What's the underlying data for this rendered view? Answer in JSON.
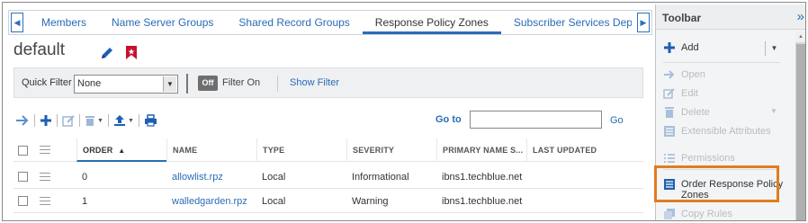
{
  "tabs": [
    {
      "label": "Members",
      "active": false
    },
    {
      "label": "Name Server Groups",
      "active": false
    },
    {
      "label": "Shared Record Groups",
      "active": false
    },
    {
      "label": "Response Policy Zones",
      "active": true
    },
    {
      "label": "Subscriber Services Deployment",
      "active": false
    }
  ],
  "page": {
    "title": "default"
  },
  "filter": {
    "quick_filter_label": "Quick Filter",
    "quick_filter_value": "None",
    "toggle_label": "Off",
    "filter_state": "Filter On",
    "show_filter": "Show Filter"
  },
  "goto": {
    "label": "Go to",
    "button": "Go",
    "value": ""
  },
  "table": {
    "columns": [
      "ORDER",
      "NAME",
      "TYPE",
      "SEVERITY",
      "PRIMARY NAME S...",
      "LAST UPDATED"
    ],
    "sort_indicator": "▲",
    "rows": [
      {
        "order": "0",
        "name": "allowlist.rpz",
        "type": "Local",
        "severity": "Informational",
        "primary": "ibns1.techblue.net",
        "updated": ""
      },
      {
        "order": "1",
        "name": "walledgarden.rpz",
        "type": "Local",
        "severity": "Warning",
        "primary": "ibns1.techblue.net",
        "updated": ""
      }
    ]
  },
  "toolbar": {
    "title": "Toolbar",
    "items": [
      {
        "label": "Add",
        "enabled": true,
        "icon": "plus-icon"
      },
      {
        "label": "Open",
        "enabled": false,
        "icon": "arrow-right-icon"
      },
      {
        "label": "Edit",
        "enabled": false,
        "icon": "pencil-icon"
      },
      {
        "label": "Delete",
        "enabled": false,
        "icon": "trash-icon"
      },
      {
        "label": "Extensible Attributes",
        "enabled": false,
        "icon": "list-icon"
      },
      {
        "label": "Permissions",
        "enabled": false,
        "icon": "list-check-icon"
      },
      {
        "label": "Order Response Policy Zones",
        "enabled": true,
        "icon": "list-icon"
      },
      {
        "label": "Copy Rules",
        "enabled": false,
        "icon": "copy-icon"
      }
    ]
  },
  "colors": {
    "link": "#2a6cb5",
    "accent_blue": "#1f5fb0",
    "bookmark_red": "#c8102e",
    "highlight_orange": "#e07d1f"
  }
}
